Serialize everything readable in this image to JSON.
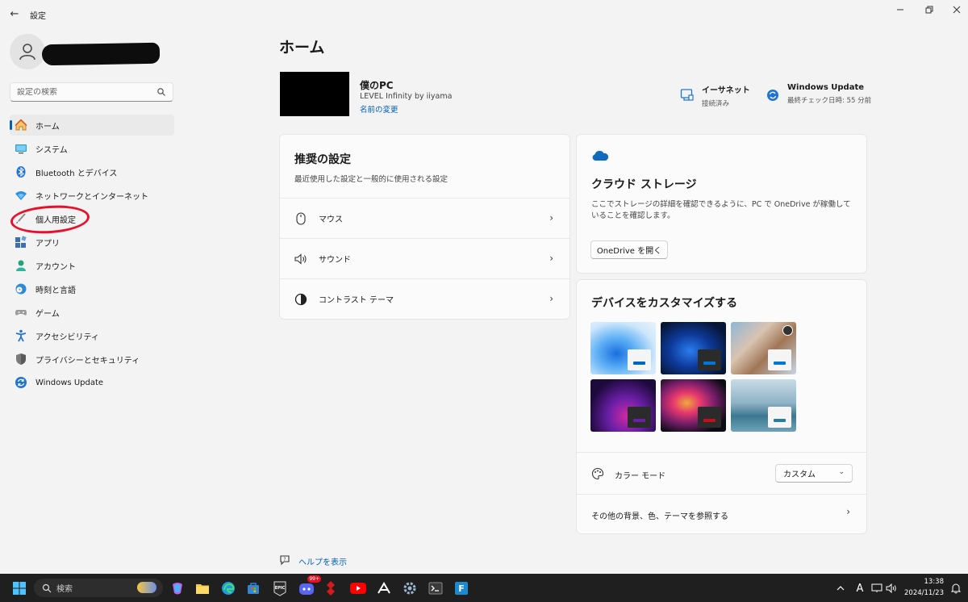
{
  "window": {
    "title": "設定",
    "back_label": "←"
  },
  "sidebar": {
    "search_placeholder": "設定の検索",
    "items": [
      {
        "label": "ホーム",
        "icon": "home-icon",
        "active": true
      },
      {
        "label": "システム",
        "icon": "system-icon"
      },
      {
        "label": "Bluetooth とデバイス",
        "icon": "bluetooth-icon"
      },
      {
        "label": "ネットワークとインターネット",
        "icon": "network-icon"
      },
      {
        "label": "個人用設定",
        "icon": "brush-icon"
      },
      {
        "label": "アプリ",
        "icon": "apps-icon"
      },
      {
        "label": "アカウント",
        "icon": "account-icon"
      },
      {
        "label": "時刻と言語",
        "icon": "time-language-icon"
      },
      {
        "label": "ゲーム",
        "icon": "gamepad-icon"
      },
      {
        "label": "アクセシビリティ",
        "icon": "accessibility-icon"
      },
      {
        "label": "プライバシーとセキュリティ",
        "icon": "shield-icon"
      },
      {
        "label": "Windows Update",
        "icon": "update-icon"
      }
    ]
  },
  "main": {
    "title": "ホーム",
    "pc": {
      "name": "僕のPC",
      "model": "LEVEL Infinity by iiyama",
      "rename": "名前の変更"
    },
    "status": [
      {
        "title": "イーサネット",
        "sub": "接続済み",
        "icon": "ethernet-icon"
      },
      {
        "title": "Windows Update",
        "sub": "最終チェック日時: 55 分前",
        "icon": "update-icon"
      }
    ],
    "recommended": {
      "title": "推奨の設定",
      "subtitle": "最近使用した設定と一般的に使用される設定",
      "items": [
        {
          "label": "マウス",
          "icon": "mouse-icon"
        },
        {
          "label": "サウンド",
          "icon": "speaker-icon"
        },
        {
          "label": "コントラスト テーマ",
          "icon": "contrast-icon"
        }
      ]
    },
    "cloud": {
      "title": "クラウド ストレージ",
      "body": "ここでストレージの詳細を確認できるように、PC で OneDrive が稼働していることを確認します。",
      "button": "OneDrive を開く"
    },
    "customize": {
      "title": "デバイスをカスタマイズする",
      "color_mode_label": "カラー モード",
      "color_mode_value": "カスタム",
      "browse_label": "その他の背景、色、テーマを参照する",
      "themes": [
        {
          "name": "windows-light",
          "accent": "#0067c0"
        },
        {
          "name": "windows-dark",
          "accent": "#0078d4"
        },
        {
          "name": "photo-spotlight",
          "accent": "#0078d4"
        },
        {
          "name": "glow",
          "accent": "#6b1fa8"
        },
        {
          "name": "captured-motion",
          "accent": "#c50f1f"
        },
        {
          "name": "flow",
          "accent": "#2d7d9a"
        }
      ]
    },
    "help": "ヘルプを表示"
  },
  "taskbar": {
    "search_label": "検索",
    "time": "13:38",
    "date": "2024/11/23",
    "ime": "A",
    "badge": "99+"
  }
}
